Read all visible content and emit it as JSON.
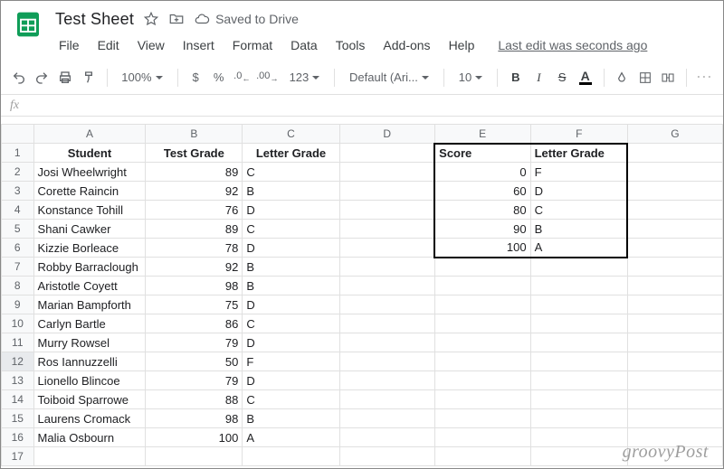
{
  "header": {
    "title": "Test Sheet",
    "saved_label": "Saved to Drive",
    "last_edit": "Last edit was seconds ago"
  },
  "menu": {
    "file": "File",
    "edit": "Edit",
    "view": "View",
    "insert": "Insert",
    "format": "Format",
    "data": "Data",
    "tools": "Tools",
    "addons": "Add-ons",
    "help": "Help"
  },
  "toolbar": {
    "zoom": "100%",
    "currency": "$",
    "percent": "%",
    "dec_dec": ".0",
    "dec_inc": ".00",
    "numfmt": "123",
    "font": "Default (Ari...",
    "font_size": "10",
    "bold": "B",
    "italic": "I",
    "strike": "S",
    "text_color": "A"
  },
  "formula_bar": {
    "fx": "fx"
  },
  "columns": [
    "A",
    "B",
    "C",
    "D",
    "E",
    "F",
    "G"
  ],
  "grid": {
    "headers": {
      "student": "Student",
      "test_grade": "Test Grade",
      "letter_grade": "Letter Grade",
      "score": "Score",
      "letter_grade2": "Letter Grade"
    },
    "students": [
      {
        "name": "Josi Wheelwright",
        "score": 89,
        "letter": "C"
      },
      {
        "name": "Corette Raincin",
        "score": 92,
        "letter": "B"
      },
      {
        "name": "Konstance Tohill",
        "score": 76,
        "letter": "D"
      },
      {
        "name": "Shani Cawker",
        "score": 89,
        "letter": "C"
      },
      {
        "name": "Kizzie Borleace",
        "score": 78,
        "letter": "D"
      },
      {
        "name": "Robby Barraclough",
        "score": 92,
        "letter": "B"
      },
      {
        "name": "Aristotle Coyett",
        "score": 98,
        "letter": "B"
      },
      {
        "name": "Marian Bampforth",
        "score": 75,
        "letter": "D"
      },
      {
        "name": "Carlyn Bartle",
        "score": 86,
        "letter": "C"
      },
      {
        "name": "Murry Rowsel",
        "score": 79,
        "letter": "D"
      },
      {
        "name": "Ros Iannuzzelli",
        "score": 50,
        "letter": "F"
      },
      {
        "name": "Lionello Blincoe",
        "score": 79,
        "letter": "D"
      },
      {
        "name": "Toiboid Sparrowe",
        "score": 88,
        "letter": "C"
      },
      {
        "name": "Laurens Cromack",
        "score": 98,
        "letter": "B"
      },
      {
        "name": "Malia Osbourn",
        "score": 100,
        "letter": "A"
      }
    ],
    "lookup": [
      {
        "score": 0,
        "letter": "F"
      },
      {
        "score": 60,
        "letter": "D"
      },
      {
        "score": 80,
        "letter": "C"
      },
      {
        "score": 90,
        "letter": "B"
      },
      {
        "score": 100,
        "letter": "A"
      }
    ]
  },
  "watermark": "groovyPost"
}
